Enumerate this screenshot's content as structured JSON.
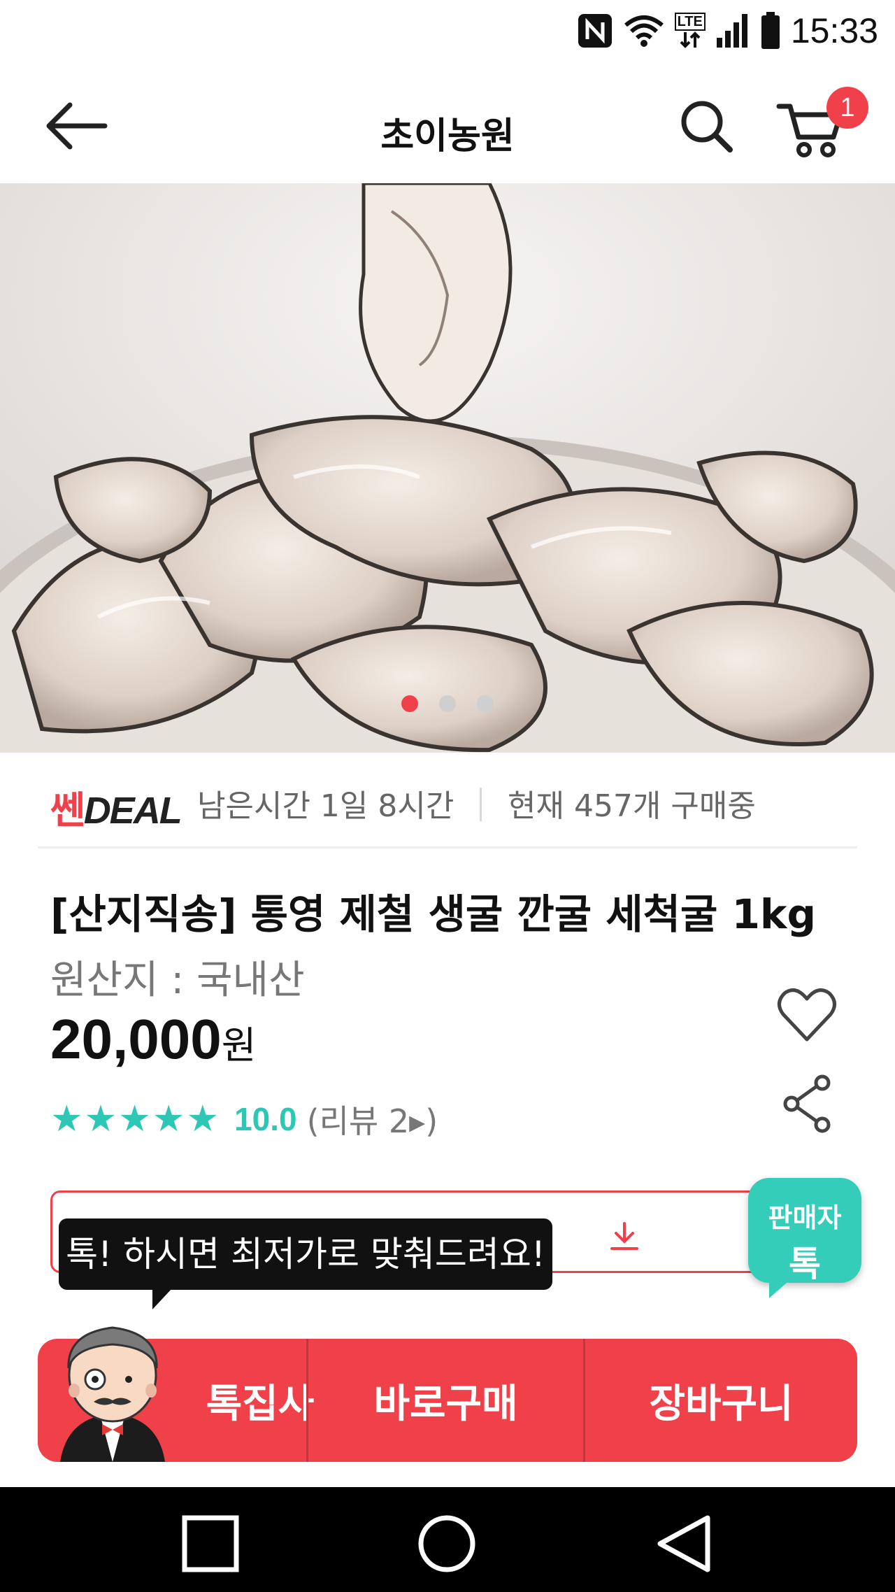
{
  "status_bar": {
    "time": "15:33",
    "network_label": "LTE"
  },
  "header": {
    "title": "초이농원",
    "cart_count": "1"
  },
  "gallery": {
    "total_images": 3,
    "active_index": 0
  },
  "deal": {
    "logo_part1": "쎈",
    "logo_part2": "DEAL",
    "remaining": "남은시간 1일 8시간",
    "buyers": "현재 457개 구매중"
  },
  "product": {
    "title": "[산지직송] 통영 제철 생굴 깐굴 세척굴 1kg",
    "origin": "원산지 : 국내산",
    "price": "20,000",
    "price_unit": "원",
    "stars": "★★★★★",
    "rating_value": 5,
    "rating_max": 5,
    "score": "10.0",
    "reviews": "(리뷰 2▸)"
  },
  "tooltip": {
    "text": "톡! 하시면 최저가로 맞춰드려요!"
  },
  "seller_talk": {
    "line1": "판매자",
    "line2": "톡"
  },
  "actions": {
    "talk": "톡집사",
    "buy": "바로구매",
    "cart": "장바구니"
  },
  "colors": {
    "accent": "#f0414b",
    "teal": "#2ec7b5"
  }
}
